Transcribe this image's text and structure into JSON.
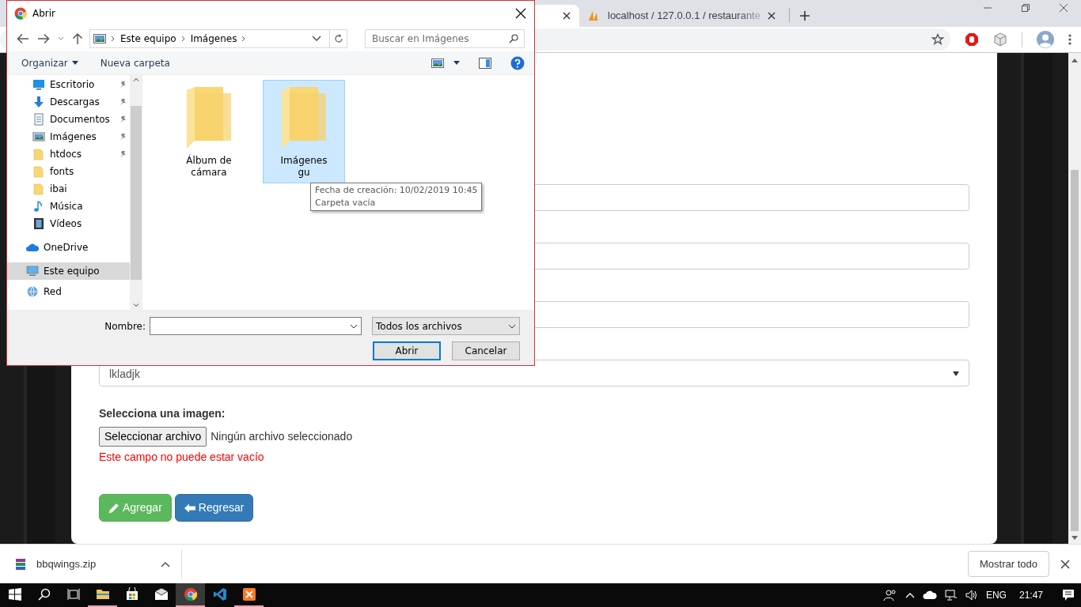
{
  "browser": {
    "tabs": [
      {
        "selected": true
      },
      {
        "label": "localhost / 127.0.0.1 / restaurante",
        "selected": false
      }
    ]
  },
  "form": {
    "fields": [
      {
        "kind": "text"
      },
      {
        "kind": "text"
      },
      {
        "kind": "text"
      },
      {
        "kind": "select",
        "value": "lkladjk"
      }
    ],
    "image_label": "Selecciona una imagen:",
    "file_button": "Seleccionar archivo",
    "file_status": "Ningún archivo seleccionado",
    "error": "Este campo no puede estar vacío",
    "actions": [
      {
        "label": "Agregar",
        "kind": "success"
      },
      {
        "label": "Regresar",
        "kind": "primary"
      }
    ]
  },
  "dialog": {
    "title": "Abrir",
    "breadcrumb": [
      "Este equipo",
      "Imágenes"
    ],
    "search": {
      "placeholder": "Buscar en Imágenes"
    },
    "commands": [
      "Organizar",
      "Nueva carpeta"
    ],
    "nav": [
      {
        "label": "Escritorio",
        "kind": "desktop",
        "pinned": true,
        "selected": false
      },
      {
        "label": "Descargas",
        "kind": "download",
        "pinned": true,
        "selected": false
      },
      {
        "label": "Documentos",
        "kind": "document",
        "pinned": true,
        "selected": false
      },
      {
        "label": "Imágenes",
        "kind": "picture",
        "pinned": true,
        "selected": false
      },
      {
        "label": "htdocs",
        "kind": "folder",
        "pinned": true,
        "selected": false
      },
      {
        "label": "fonts",
        "kind": "folder",
        "pinned": false,
        "selected": false
      },
      {
        "label": "ibai",
        "kind": "folder",
        "pinned": false,
        "selected": false
      },
      {
        "label": "Música",
        "kind": "music",
        "pinned": false,
        "selected": false
      },
      {
        "label": "Vídeos",
        "kind": "video",
        "pinned": false,
        "selected": false
      },
      {
        "label": "OneDrive",
        "kind": "cloud",
        "pinned": false,
        "selected": false
      },
      {
        "label": "Este equipo",
        "kind": "computer",
        "pinned": false,
        "selected": true
      },
      {
        "label": "Red",
        "kind": "network",
        "pinned": false,
        "selected": false
      }
    ],
    "files": [
      {
        "label": "Álbum de cámara",
        "selected": false
      },
      {
        "label": "Imágenes gu",
        "selected": true
      }
    ],
    "tooltip": [
      "Fecha de creación: 10/02/2019 10:45",
      "Carpeta vacía"
    ],
    "filename_label": "Nombre:",
    "filter": "Todos los archivos",
    "buttons": [
      {
        "label": "Abrir",
        "default": true
      },
      {
        "label": "Cancelar",
        "default": false
      }
    ]
  },
  "downloads": {
    "file": "bbqwings.zip",
    "show_all": "Mostrar todo"
  },
  "taskbar": {
    "apps": [
      {
        "kind": "explorer",
        "running": true,
        "active": false
      },
      {
        "kind": "store",
        "running": false,
        "active": false
      },
      {
        "kind": "mail",
        "running": false,
        "active": false
      },
      {
        "kind": "chrome",
        "running": true,
        "active": true
      },
      {
        "kind": "vscode",
        "running": false,
        "active": false
      },
      {
        "kind": "xampp",
        "running": true,
        "active": false
      }
    ],
    "language": "ENG",
    "time": "21:47"
  }
}
